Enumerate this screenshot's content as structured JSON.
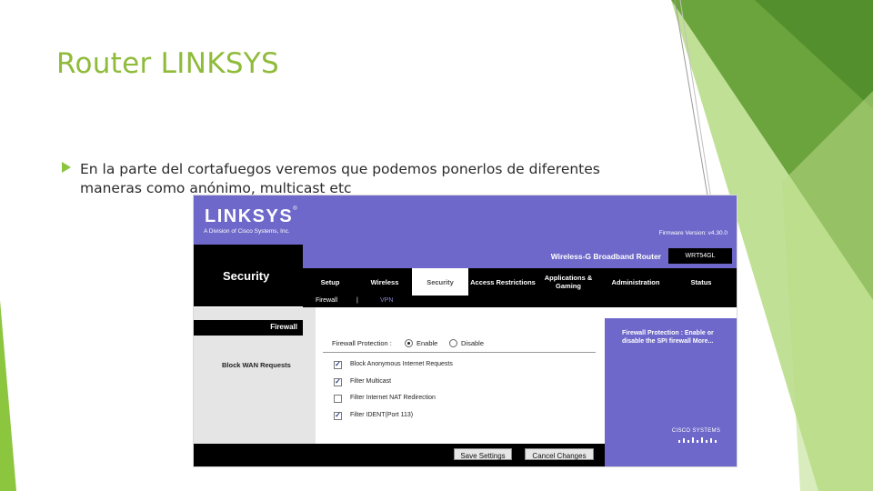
{
  "slide": {
    "title": "Router LINKSYS",
    "bullet": "En la parte del cortafuegos veremos que podemos ponerlos de diferentes maneras como anónimo, multicast etc",
    "accent_color": "#8cc63e"
  },
  "router": {
    "brand": "LINKSYS",
    "tagline": "A Division of Cisco Systems, Inc.",
    "firmware": "Firmware Version: v4.30.0",
    "section": "Security",
    "product_name": "Wireless-G Broadband Router",
    "model": "WRT54GL",
    "tabs": [
      {
        "label": "Setup"
      },
      {
        "label": "Wireless"
      },
      {
        "label": "Security"
      },
      {
        "label": "Access Restrictions"
      },
      {
        "label": "Applications & Gaming"
      },
      {
        "label": "Administration"
      },
      {
        "label": "Status"
      }
    ],
    "subtabs": [
      "Firewall",
      "|",
      "VPN"
    ],
    "sidebar_heading": "Firewall",
    "block_wan_label": "Block WAN Requests",
    "firewall_protection_label": "Firewall Protection :",
    "enable_label": "Enable",
    "disable_label": "Disable",
    "options": [
      {
        "label": "Block Anonymous Internet Requests",
        "checked": true
      },
      {
        "label": "Filter Multicast",
        "checked": true
      },
      {
        "label": "Filter Internet NAT Redirection",
        "checked": false
      },
      {
        "label": "Filter IDENT(Port 113)",
        "checked": true
      }
    ],
    "help_text": "Firewall Protection : Enable or disable the SPI firewall More...",
    "cisco_logo": "CISCO SYSTEMS",
    "save_button": "Save Settings",
    "cancel_button": "Cancel Changes",
    "brand_color": "#6d68c9"
  }
}
